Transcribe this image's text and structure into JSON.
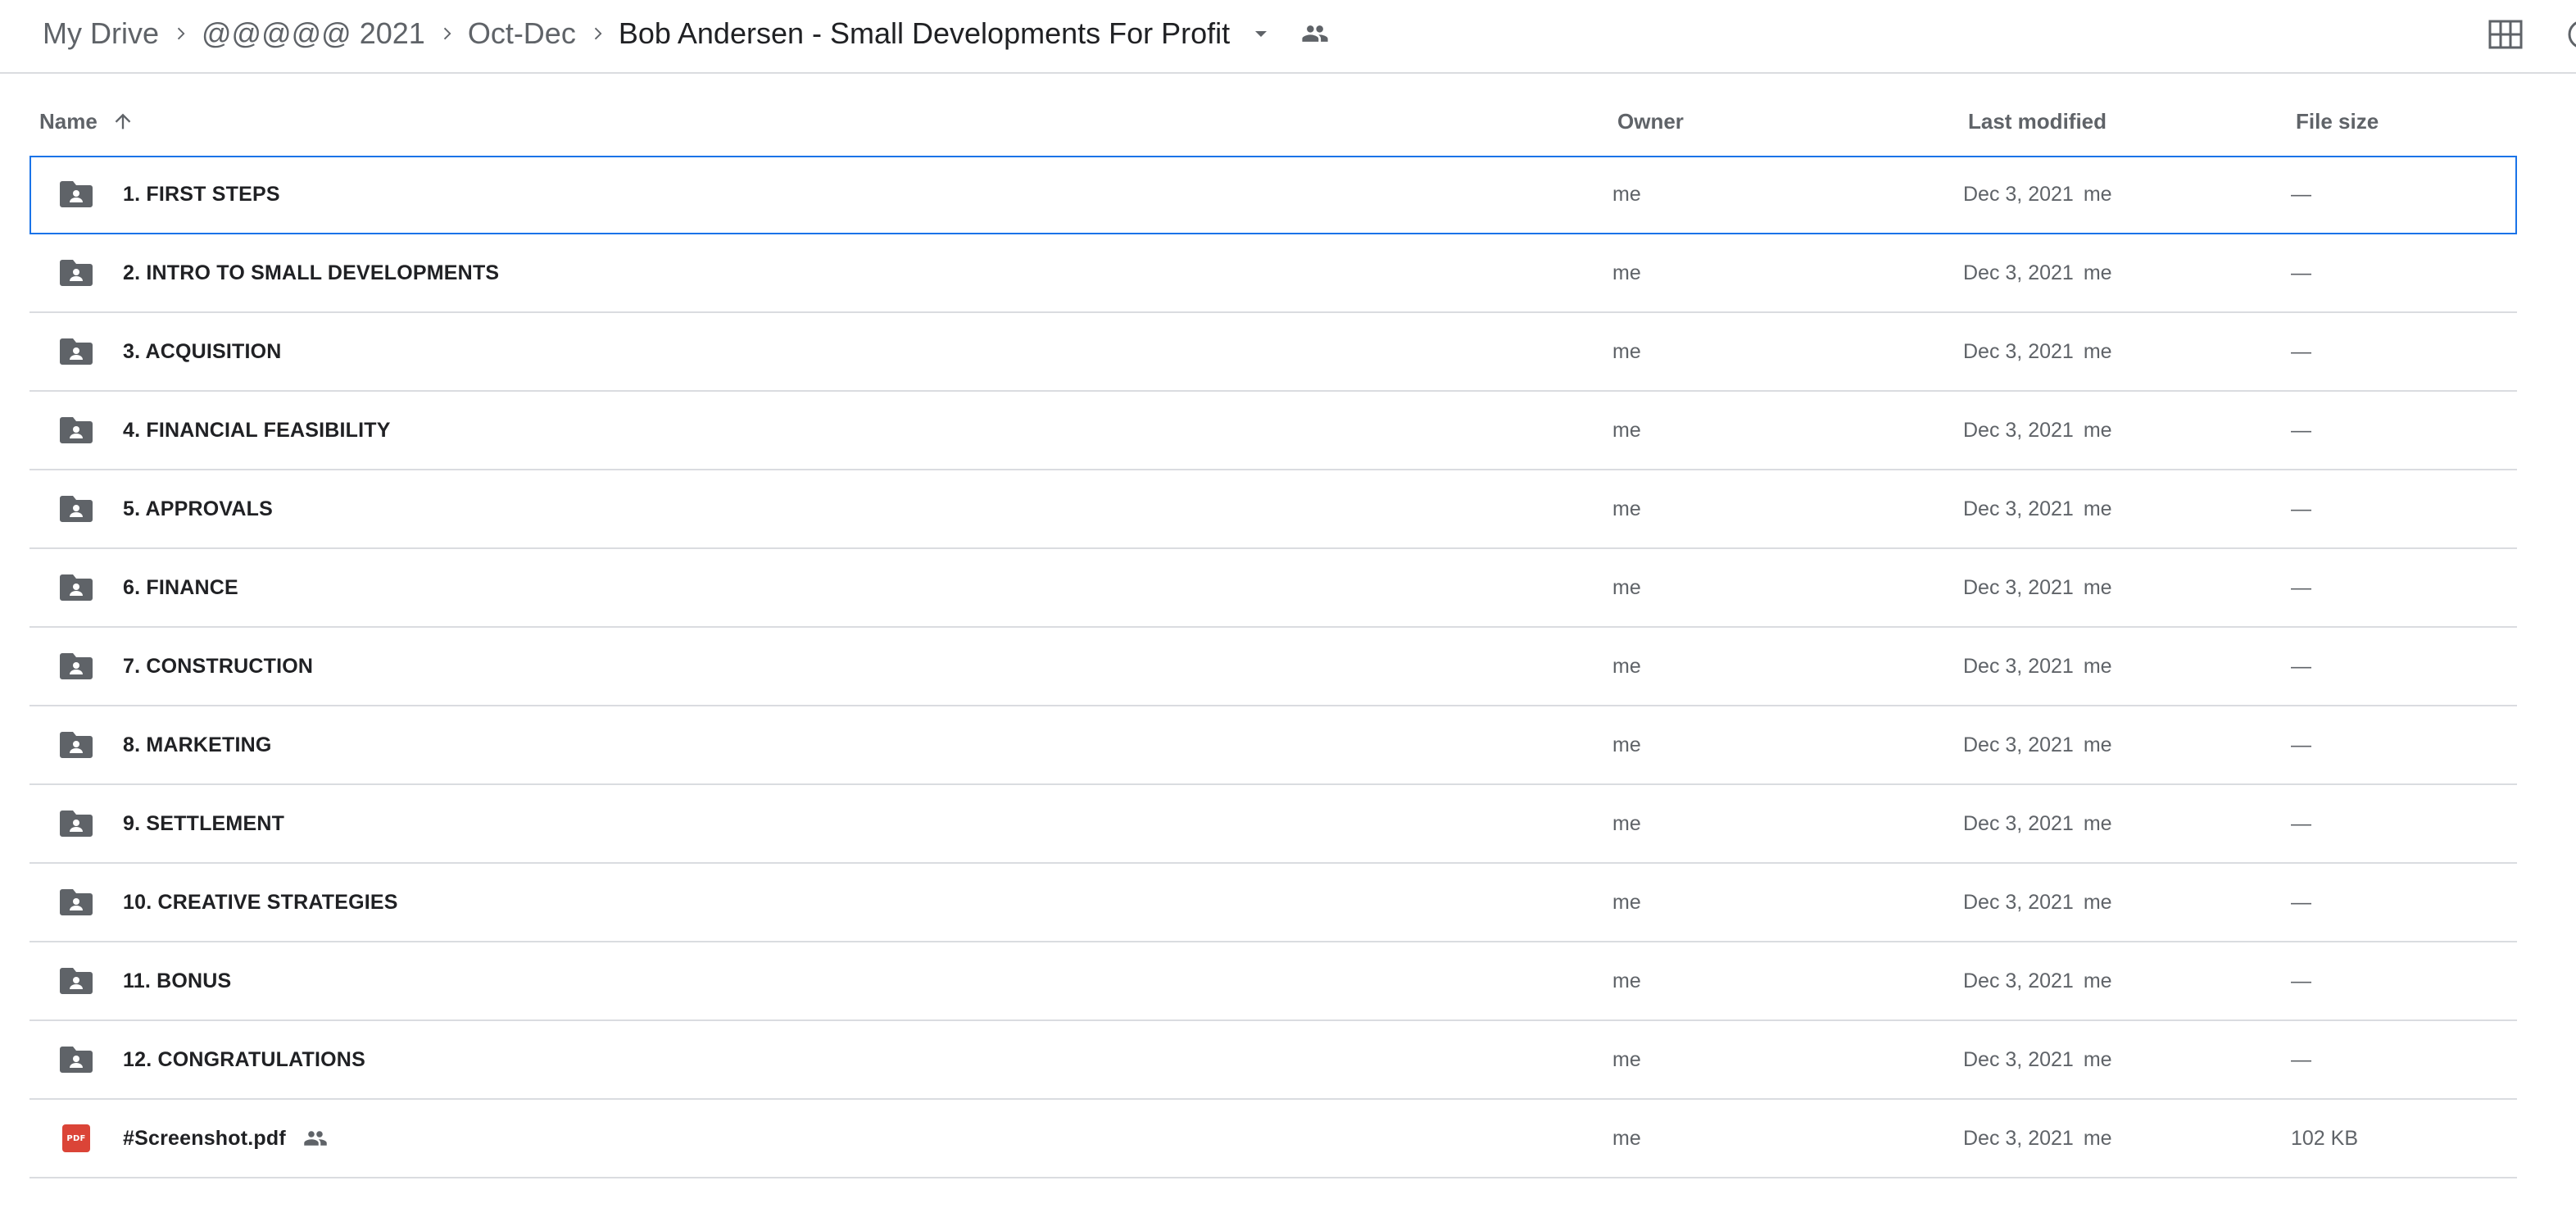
{
  "breadcrumb": {
    "items": [
      "My Drive",
      "@@@@@ 2021",
      "Oct-Dec"
    ],
    "current": "Bob Andersen - Small Developments For Profit"
  },
  "icons": {
    "chevron": "chevron-right-icon",
    "caret": "caret-down-icon",
    "shared": "people-icon",
    "grid": "grid-view-icon",
    "folder": "shared-folder-icon",
    "pdf": "pdf-icon",
    "sort": "arrow-up-icon"
  },
  "colors": {
    "selection": "#1a73e8",
    "pdf": "#db4437",
    "folder": "#5f6368"
  },
  "columns": {
    "name": "Name",
    "owner": "Owner",
    "last_modified": "Last modified",
    "file_size": "File size"
  },
  "pdf_badge": "PDF",
  "rows": [
    {
      "name": "1. FIRST STEPS",
      "type": "folder",
      "owner": "me",
      "modified": "Dec 3, 2021",
      "modified_by": "me",
      "size": "—"
    },
    {
      "name": "2. INTRO TO SMALL DEVELOPMENTS",
      "type": "folder",
      "owner": "me",
      "modified": "Dec 3, 2021",
      "modified_by": "me",
      "size": "—"
    },
    {
      "name": "3. ACQUISITION",
      "type": "folder",
      "owner": "me",
      "modified": "Dec 3, 2021",
      "modified_by": "me",
      "size": "—"
    },
    {
      "name": "4. FINANCIAL FEASIBILITY",
      "type": "folder",
      "owner": "me",
      "modified": "Dec 3, 2021",
      "modified_by": "me",
      "size": "—"
    },
    {
      "name": "5. APPROVALS",
      "type": "folder",
      "owner": "me",
      "modified": "Dec 3, 2021",
      "modified_by": "me",
      "size": "—"
    },
    {
      "name": "6. FINANCE",
      "type": "folder",
      "owner": "me",
      "modified": "Dec 3, 2021",
      "modified_by": "me",
      "size": "—"
    },
    {
      "name": "7. CONSTRUCTION",
      "type": "folder",
      "owner": "me",
      "modified": "Dec 3, 2021",
      "modified_by": "me",
      "size": "—"
    },
    {
      "name": "8. MARKETING",
      "type": "folder",
      "owner": "me",
      "modified": "Dec 3, 2021",
      "modified_by": "me",
      "size": "—"
    },
    {
      "name": "9. SETTLEMENT",
      "type": "folder",
      "owner": "me",
      "modified": "Dec 3, 2021",
      "modified_by": "me",
      "size": "—"
    },
    {
      "name": "10. CREATIVE STRATEGIES",
      "type": "folder",
      "owner": "me",
      "modified": "Dec 3, 2021",
      "modified_by": "me",
      "size": "—"
    },
    {
      "name": "11. BONUS",
      "type": "folder",
      "owner": "me",
      "modified": "Dec 3, 2021",
      "modified_by": "me",
      "size": "—"
    },
    {
      "name": "12. CONGRATULATIONS",
      "type": "folder",
      "owner": "me",
      "modified": "Dec 3, 2021",
      "modified_by": "me",
      "size": "—"
    },
    {
      "name": "#Screenshot.pdf",
      "type": "pdf",
      "shared": true,
      "owner": "me",
      "modified": "Dec 3, 2021",
      "modified_by": "me",
      "size": "102 KB"
    }
  ],
  "selected_row": 0
}
